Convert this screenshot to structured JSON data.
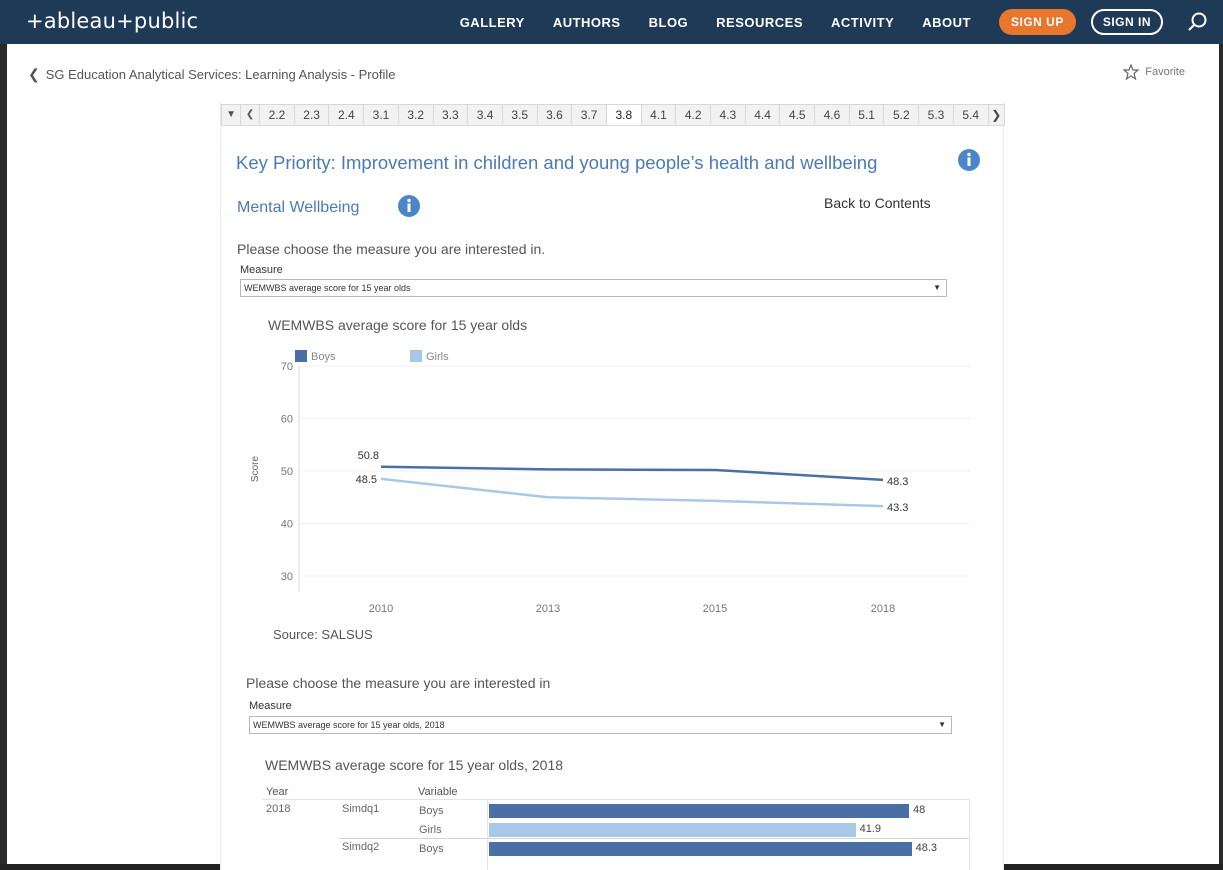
{
  "nav": {
    "logo": "+ableau+public",
    "items": [
      "GALLERY",
      "AUTHORS",
      "BLOG",
      "RESOURCES",
      "ACTIVITY",
      "ABOUT"
    ],
    "signup": "SIGN UP",
    "signin": "SIGN IN"
  },
  "breadcrumb": "SG Education Analytical Services: Learning Analysis - Profile",
  "favorite": "Favorite",
  "tabs": [
    "2.2",
    "2.3",
    "2.4",
    "3.1",
    "3.2",
    "3.3",
    "3.4",
    "3.5",
    "3.6",
    "3.7",
    "3.8",
    "4.1",
    "4.2",
    "4.3",
    "4.4",
    "4.5",
    "4.6",
    "5.1",
    "5.2",
    "5.3",
    "5.4"
  ],
  "active_tab": "3.8",
  "dashboard": {
    "key_priority": "Key Priority: Improvement in children and young people’s health and wellbeing",
    "section_title": "Mental Wellbeing",
    "back_link": "Back to Contents",
    "prompt1": "Please choose the measure you are interested in.",
    "measure_label": "Measure",
    "measure1_value": "WEMWBS average score for 15 year olds",
    "chart1_title": "WEMWBS average score for 15 year olds",
    "source": "Source: SALSUS",
    "prompt2": "Please choose the measure you are interested in",
    "measure2_value": "WEMWBS average score for 15 year olds, 2018",
    "chart2_title": "WEMWBS average score for 15 year olds, 2018"
  },
  "colors": {
    "boys": "#4a6fa5",
    "girls": "#a9c8e8",
    "nav_bg": "#1f3a57",
    "accent": "#e8762d",
    "title_blue": "#4a7bb7"
  },
  "chart_data": [
    {
      "type": "line",
      "title": "WEMWBS average score for 15 year olds",
      "ylabel": "Score",
      "xlabel": "",
      "x": [
        "2010",
        "2013",
        "2015",
        "2018"
      ],
      "ylim": [
        30,
        70
      ],
      "yticks": [
        "70",
        "60",
        "50",
        "40",
        "30"
      ],
      "grid": true,
      "legend": "top-left",
      "series": [
        {
          "name": "Boys",
          "values": [
            50.8,
            50.3,
            50.2,
            48.3
          ],
          "labels": [
            "50.8",
            "48.3"
          ]
        },
        {
          "name": "Girls",
          "values": [
            48.5,
            45.0,
            44.3,
            43.3
          ],
          "labels": [
            "48.5",
            "43.3"
          ]
        }
      ]
    },
    {
      "type": "bar",
      "title": "WEMWBS average score for 15 year olds, 2018",
      "headers": {
        "year": "Year",
        "variable": "Variable"
      },
      "year": "2018",
      "rows": [
        {
          "group": "Simdq1",
          "variable": "Boys",
          "value": 48,
          "label": "48"
        },
        {
          "group": "",
          "variable": "Girls",
          "value": 41.9,
          "label": "41.9"
        },
        {
          "group": "Simdq2",
          "variable": "Boys",
          "value": 48.3,
          "label": "48.3"
        }
      ]
    }
  ]
}
